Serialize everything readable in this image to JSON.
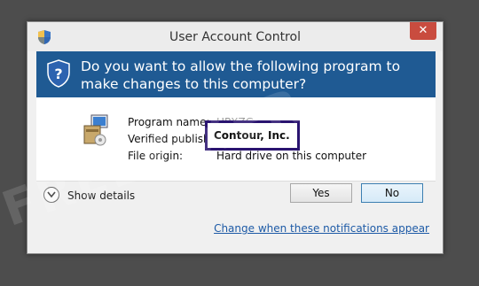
{
  "window": {
    "title": "User Account Control",
    "close_glyph": "✕"
  },
  "header": {
    "question": "Do you want to allow the following program to make changes to this computer?",
    "band_color": "#1f5a93",
    "icon": "uac-shield-icon"
  },
  "details": {
    "program_name_label": "Program name:",
    "program_name_value": "HPXZG",
    "publisher_label": "Verified publisher:",
    "publisher_value": "Contour, Inc.",
    "origin_label": "File origin:",
    "origin_value": "Hard drive on this computer",
    "highlight_color": "#2a1470"
  },
  "footer": {
    "show_details": "Show details",
    "yes": "Yes",
    "no": "No",
    "notifications_link": "Change when these notifications appear"
  },
  "watermark": "FREEFIXER"
}
